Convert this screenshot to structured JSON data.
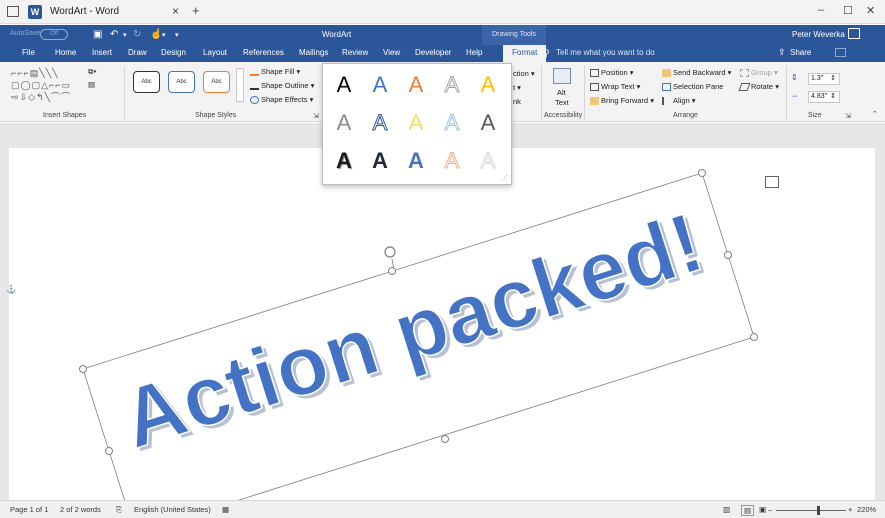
{
  "window": {
    "title": "WordArt - Word",
    "tab_close": "×",
    "new_tab": "+",
    "minimize": "–",
    "maximize": "☐",
    "close": "✕"
  },
  "qat": {
    "autosave_label": "AutoSave",
    "autosave_state": "Off",
    "doc_title": "WordArt",
    "contextual_tools": "Drawing Tools",
    "user_name": "Peter Weverka"
  },
  "tabs": [
    "File",
    "Home",
    "Insert",
    "Draw",
    "Design",
    "Layout",
    "References",
    "Mailings",
    "Review",
    "View",
    "Developer",
    "Help",
    "Format"
  ],
  "tell_me": "Tell me what you want to do",
  "share_label": "Share",
  "ribbon": {
    "insert_shapes_label": "Insert Shapes",
    "shape_styles_label": "Shape Styles",
    "style_sample": "Abc",
    "shape_fill": "Shape Fill",
    "shape_outline": "Shape Outline",
    "shape_effects": "Shape Effects",
    "text_direction_partial": "ction",
    "align_text_partial": "t",
    "link_partial": "nk",
    "alt_text_line1": "Alt",
    "alt_text_line2": "Text",
    "accessibility_label": "Accessibility",
    "position": "Position",
    "wrap_text": "Wrap Text",
    "bring_forward": "Bring Forward",
    "send_backward": "Send Backward",
    "selection_pane": "Selection Pane",
    "align": "Align",
    "group": "Group",
    "rotate": "Rotate",
    "arrange_label": "Arrange",
    "height_value": "1.3\"",
    "width_value": "4.83\"",
    "size_label": "Size"
  },
  "wordart_gallery": {
    "glyph": "A",
    "colors": [
      [
        "#000000",
        "#4472c4",
        "#ed7d31",
        "#a5a5a5",
        "#ffc000"
      ],
      [
        "#8c8c8c",
        "#2f5597",
        "#ffd966",
        "#9dc3e6",
        "#595959"
      ],
      [
        "#1a1a1a",
        "#222a35",
        "#4472c4",
        "#f4b183",
        "#d9d9d9"
      ]
    ]
  },
  "document": {
    "wordart_text": "Action packed!",
    "wordart_color": "#4472c4"
  },
  "status": {
    "page": "Page 1 of 1",
    "words": "2 of 2 words",
    "language": "English (United States)",
    "zoom": "220%"
  }
}
